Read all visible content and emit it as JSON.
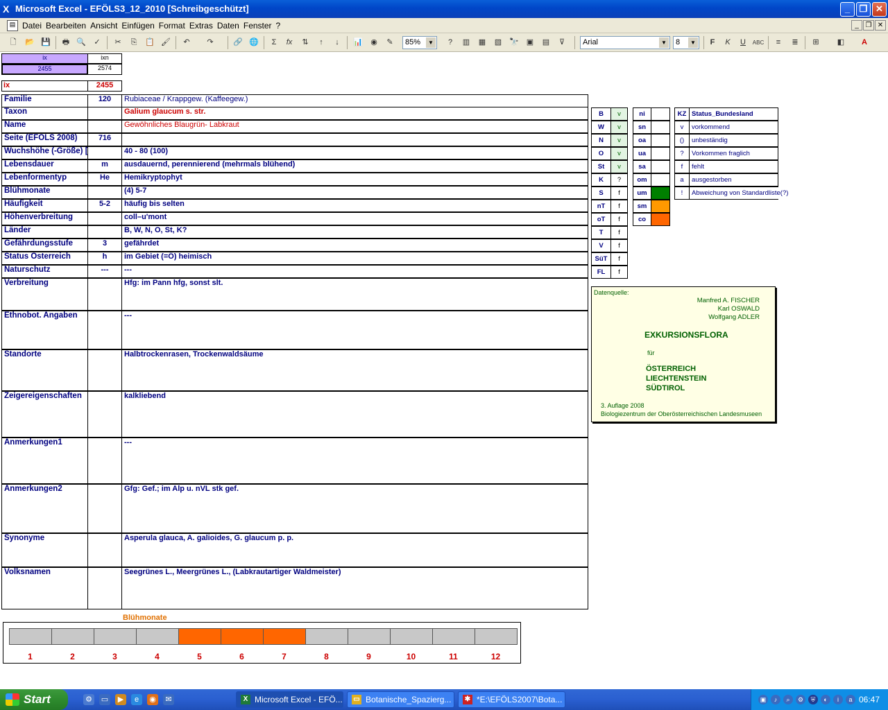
{
  "window": {
    "title": "Microsoft Excel - EFÖLS3_12_2010  [Schreibgeschützt]",
    "min": "_",
    "restore": "❐",
    "close": "✕"
  },
  "menu": {
    "items": [
      "Datei",
      "Bearbeiten",
      "Ansicht",
      "Einfügen",
      "Format",
      "Extras",
      "Daten",
      "Fenster",
      "?"
    ]
  },
  "toolbar": {
    "zoom": "85%",
    "font": "Arial",
    "size": "8"
  },
  "header_cells": {
    "ix_label": "ix",
    "ixn_label": "ixn",
    "ix_value": "2455",
    "ixn_value": "2574",
    "ix2_label": "ix",
    "ix2_value": "2455"
  },
  "rows": [
    {
      "label": "Familie",
      "code": "120",
      "value": "Rubiaceae  /  Krappgew. (Kaffeegew.)"
    },
    {
      "label": "Taxon",
      "code": "",
      "value": "Galium glaucum s. str."
    },
    {
      "label": "Name",
      "code": "",
      "value": "Gewöhnliches Blaugrün- Labkraut"
    },
    {
      "label": "Seite (EFÖLS 2008)",
      "code": "716",
      "value": ""
    },
    {
      "label": "Wuchshöhe (-Größe) [cm]",
      "code": "",
      "value": " 40 - 80 (100)"
    },
    {
      "label": "Lebensdauer",
      "code": "m",
      "value": "ausdauernd, perennierend (mehrmals blühend)"
    },
    {
      "label": "Lebenformentyp",
      "code": "He",
      "value": "Hemikryptophyt"
    },
    {
      "label": "Blühmonate",
      "code": "",
      "value": "(4) 5-7"
    },
    {
      "label": "Häufigkeit",
      "code": "5-2",
      "value": "häufig bis selten"
    },
    {
      "label": "Höhenverbreitung",
      "code": "",
      "value": "coll–u'mont"
    },
    {
      "label": "Länder",
      "code": "",
      "value": "B, W, N, O, St, K?"
    },
    {
      "label": "Gefährdungsstufe",
      "code": "3",
      "value": "gefährdet"
    },
    {
      "label": "Status Österreich",
      "code": "h",
      "value": "im Gebiet (=Ö) heimisch"
    },
    {
      "label": "Naturschutz",
      "code": "---",
      "value": "---"
    },
    {
      "label": "Verbreitung",
      "code": "",
      "value": "Hfg: im Pann hfg, sonst slt."
    },
    {
      "label": "Ethnobot. Angaben",
      "code": "",
      "value": "---"
    },
    {
      "label": "Standorte",
      "code": "",
      "value": "Halbtrockenrasen, Trockenwaldsäume"
    },
    {
      "label": "Zeigereigenschaften",
      "code": "",
      "value": "kalkliebend"
    },
    {
      "label": "Anmerkungen1",
      "code": "",
      "value": "---"
    },
    {
      "label": "Anmerkungen2",
      "code": "",
      "value": "Gfg: Gef.; im Alp u. nVL stk gef."
    },
    {
      "label": "Synonyme",
      "code": "",
      "value": "Asperula glauca, A. galioides, G. glaucum p. p."
    },
    {
      "label": "Volksnamen",
      "code": "",
      "value": "Seegrünes L., Meergrünes L.,   (Labkrautartiger Waldmeister)"
    }
  ],
  "states": [
    {
      "code": "B",
      "status": "v"
    },
    {
      "code": "W",
      "status": "v"
    },
    {
      "code": "N",
      "status": "v"
    },
    {
      "code": "O",
      "status": "v"
    },
    {
      "code": "St",
      "status": "v"
    },
    {
      "code": "K",
      "status": "?"
    },
    {
      "code": "S",
      "status": "f"
    },
    {
      "code": "nT",
      "status": "f"
    },
    {
      "code": "oT",
      "status": "f"
    },
    {
      "code": "T",
      "status": "f"
    },
    {
      "code": "V",
      "status": "f"
    },
    {
      "code": "SüT",
      "status": "f"
    },
    {
      "code": "FL",
      "status": "f"
    }
  ],
  "altitudes": [
    {
      "code": "ni",
      "color": ""
    },
    {
      "code": "sn",
      "color": ""
    },
    {
      "code": "oa",
      "color": ""
    },
    {
      "code": "ua",
      "color": ""
    },
    {
      "code": "sa",
      "color": ""
    },
    {
      "code": "om",
      "color": ""
    },
    {
      "code": "um",
      "color": "#008000"
    },
    {
      "code": "sm",
      "color": "#ff9900"
    },
    {
      "code": "co",
      "color": "#ff6600"
    }
  ],
  "legend": {
    "header_code": "KZ",
    "header_label": "Status_Bundesland",
    "items": [
      {
        "code": "v",
        "label": "vorkommend"
      },
      {
        "code": "()",
        "label": "unbeständig"
      },
      {
        "code": "?",
        "label": "Vorkommen fraglich"
      },
      {
        "code": "f",
        "label": "fehlt"
      },
      {
        "code": "a",
        "label": "ausgestorben"
      },
      {
        "code": "!",
        "label": "Abweichung von Standardliste(?)"
      }
    ]
  },
  "source": {
    "heading": "Datenquelle:",
    "author1": "Manfred A. FISCHER",
    "author2": "Karl OSWALD",
    "author3": "Wolfgang ADLER",
    "book": "EXKURSIONSFLORA",
    "fuer": "für",
    "country1": "ÖSTERREICH",
    "country2": "LIECHTENSTEIN",
    "country3": "SÜDTIROL",
    "edition": "3. Auflage 2008",
    "publisher": "Biologiezentrum der Oberösterreichischen Landesmuseen"
  },
  "bloom": {
    "title": "Blühmonate",
    "months": [
      "1",
      "2",
      "3",
      "4",
      "5",
      "6",
      "7",
      "8",
      "9",
      "10",
      "11",
      "12"
    ],
    "flowering": [
      5,
      6,
      7
    ],
    "active_color": "#ff6600",
    "inactive_color": "#c8c8c8"
  },
  "taskbar": {
    "start": "Start",
    "tasks": [
      "Microsoft Excel - EFÖ...",
      "Botanische_Spazierg...",
      "*E:\\EFÖLS2007\\Bota..."
    ],
    "clock": "06:47"
  }
}
